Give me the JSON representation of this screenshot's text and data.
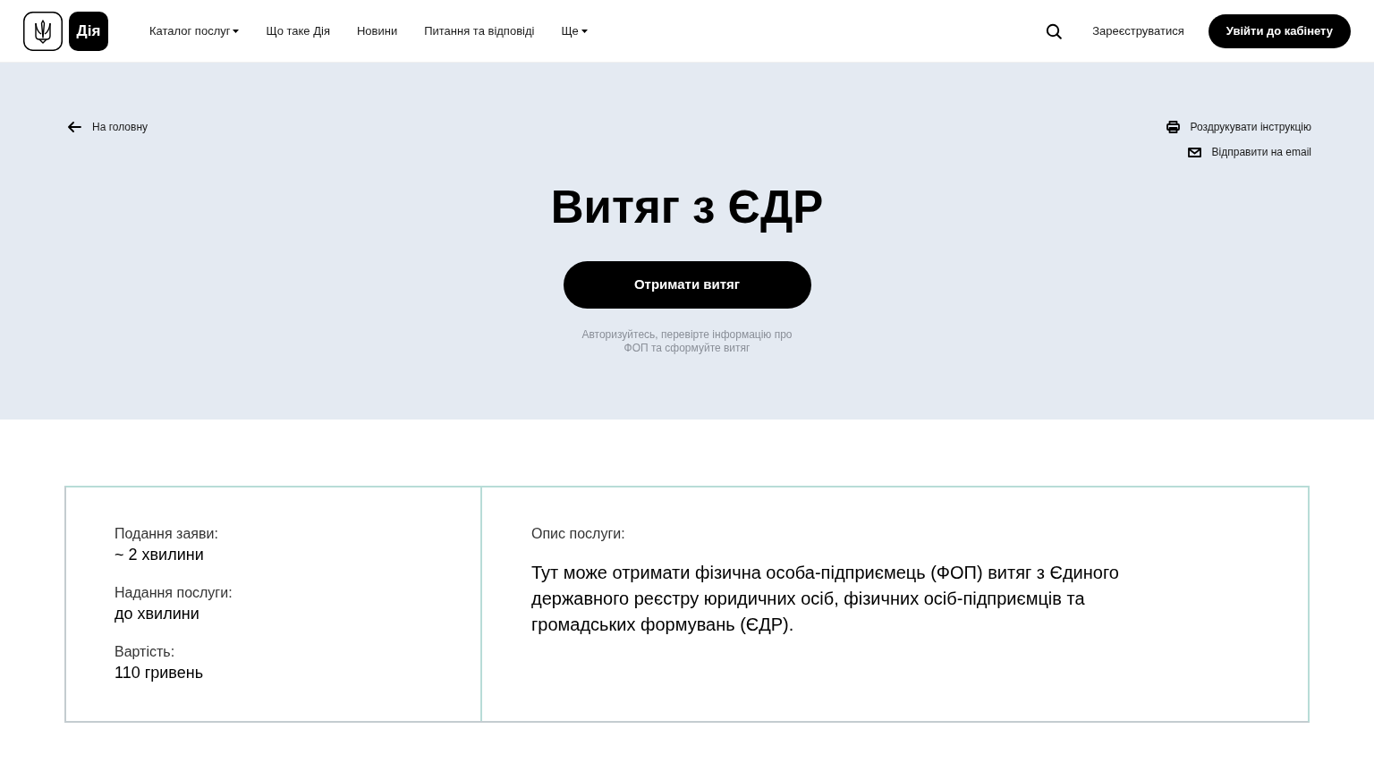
{
  "header": {
    "logo_text": "Дія",
    "nav": [
      {
        "label": "Каталог послуг",
        "kind": "dropdown"
      },
      {
        "label": "Що таке Дія",
        "kind": "link"
      },
      {
        "label": "Новини",
        "kind": "link"
      },
      {
        "label": "Питання та відповіді",
        "kind": "link"
      },
      {
        "label": "Ще",
        "kind": "dropdown"
      }
    ],
    "register_link": "Зареєструватися",
    "login_button": "Увійти до кабінету"
  },
  "hero": {
    "back_link": "На головну",
    "actions": [
      {
        "label": "Роздрукувати інструкцію",
        "kind": "print"
      },
      {
        "label": "Відправити на email",
        "kind": "email"
      }
    ],
    "title": "Витяг з ЄДР",
    "cta_button": "Отримати витяг",
    "hint": "Авторизуйтесь, перевірте інформацію про ФОП та сформуйте витяг"
  },
  "details": {
    "facts": [
      {
        "label": "Подання заяви:",
        "value": "~ 2 хвилини"
      },
      {
        "label": "Надання послуги:",
        "value": "до хвилини"
      },
      {
        "label": "Вартість:",
        "value": "110 гривень"
      }
    ],
    "description_label": "Опис послуги:",
    "description": "Тут може отримати фізична особа-підприємець (ФОП) витяг з Єдиного державного реєстру юридичних осіб, фізичних осіб-підприємців та громадських формувань (ЄДР)."
  }
}
